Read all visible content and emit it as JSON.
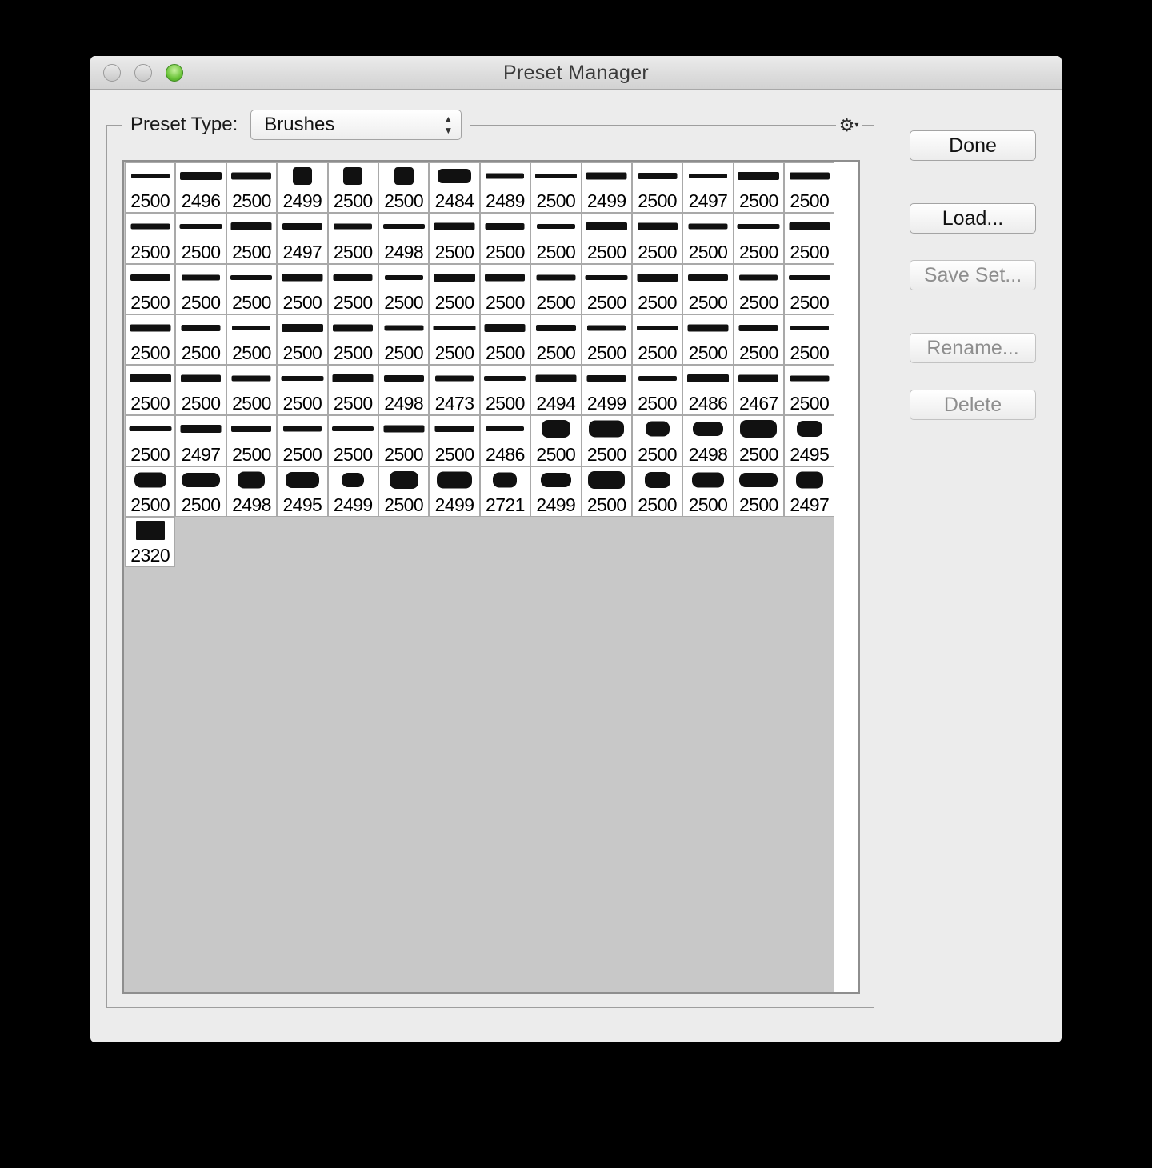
{
  "window": {
    "title": "Preset Manager"
  },
  "preset": {
    "label": "Preset Type:",
    "selected": "Brushes"
  },
  "buttons": {
    "done": "Done",
    "load": "Load...",
    "save_set": "Save Set...",
    "rename": "Rename...",
    "delete": "Delete"
  },
  "icons": {
    "menu": "gear-icon",
    "close": "close-icon",
    "minimize": "minimize-icon",
    "zoom": "zoom-icon"
  },
  "colors": {
    "window_bg": "#ececec",
    "grid_empty": "#c8c8c8",
    "zoom_green": "#6cc43a"
  },
  "brush_sizes": [
    [
      "2500",
      "2496",
      "2500",
      "2499",
      "2500",
      "2500",
      "2484",
      "2489",
      "2500",
      "2499",
      "2500",
      "2497",
      "2500",
      "2500"
    ],
    [
      "2500",
      "2500",
      "2500",
      "2497",
      "2500",
      "2498",
      "2500",
      "2500",
      "2500",
      "2500",
      "2500",
      "2500",
      "2500",
      "2500"
    ],
    [
      "2500",
      "2500",
      "2500",
      "2500",
      "2500",
      "2500",
      "2500",
      "2500",
      "2500",
      "2500",
      "2500",
      "2500",
      "2500",
      "2500"
    ],
    [
      "2500",
      "2500",
      "2500",
      "2500",
      "2500",
      "2500",
      "2500",
      "2500",
      "2500",
      "2500",
      "2500",
      "2500",
      "2500",
      "2500"
    ],
    [
      "2500",
      "2500",
      "2500",
      "2500",
      "2500",
      "2498",
      "2473",
      "2500",
      "2494",
      "2499",
      "2500",
      "2486",
      "2467",
      "2500"
    ],
    [
      "2500",
      "2497",
      "2500",
      "2500",
      "2500",
      "2500",
      "2500",
      "2486",
      "2500",
      "2500",
      "2500",
      "2498",
      "2500",
      "2495"
    ],
    [
      "2500",
      "2500",
      "2498",
      "2495",
      "2499",
      "2500",
      "2499",
      "2721",
      "2499",
      "2500",
      "2500",
      "2500",
      "2500",
      "2497"
    ],
    [
      "2320"
    ]
  ]
}
